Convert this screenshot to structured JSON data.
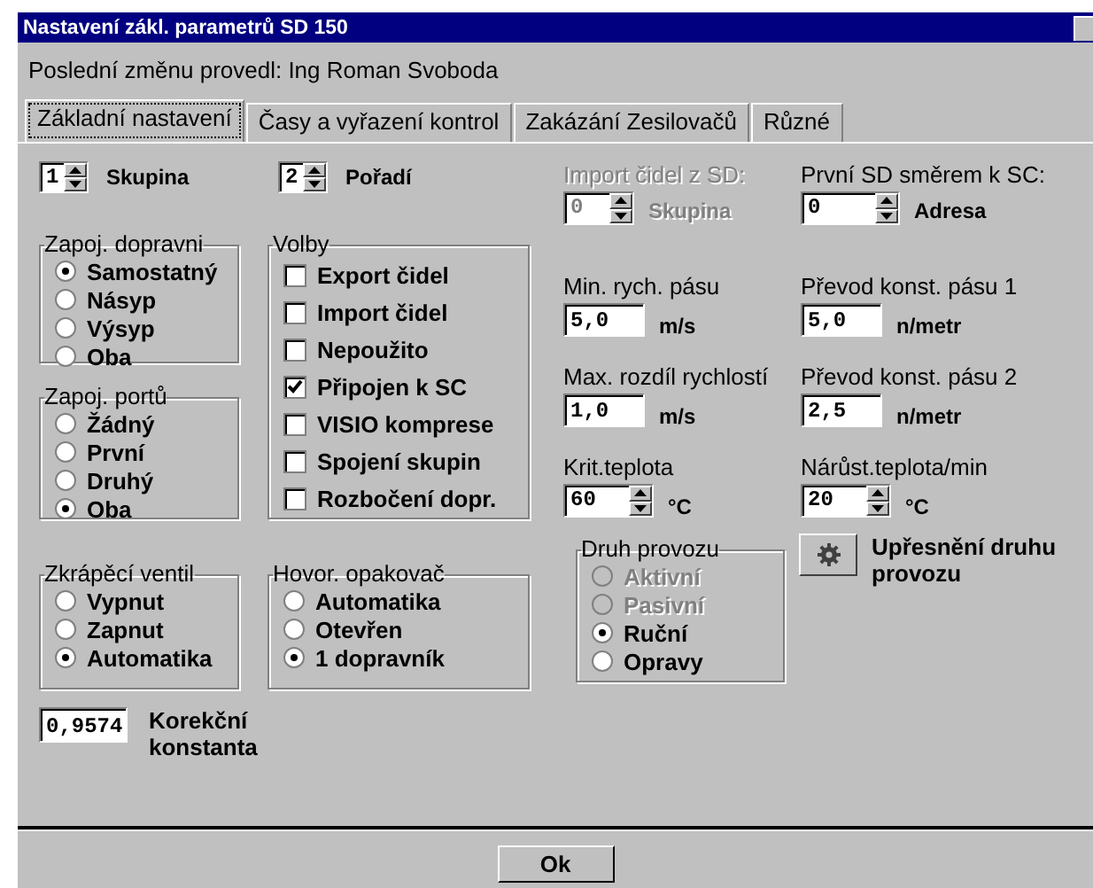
{
  "window": {
    "title": "Nastavení zákl. parametrů SD 150"
  },
  "last_change": "Poslední změnu provedl: Ing Roman Svoboda",
  "tabs": [
    {
      "label": "Základní nastavení",
      "selected": true
    },
    {
      "label": "Časy a vyřazení kontrol",
      "selected": false
    },
    {
      "label": "Zakázání Zesilovačů",
      "selected": false
    },
    {
      "label": "Různé",
      "selected": false
    }
  ],
  "top_spinners": [
    {
      "value": "1",
      "label": "Skupina"
    },
    {
      "value": "2",
      "label": "Pořadí"
    }
  ],
  "connection_groups": [
    {
      "title": "Zapoj. dopravni",
      "options": [
        {
          "label": "Samostatný",
          "selected": true
        },
        {
          "label": "Násyp",
          "selected": false
        },
        {
          "label": "Výsyp",
          "selected": false
        },
        {
          "label": "Oba",
          "selected": false
        }
      ]
    },
    {
      "title": "Zapoj. portů",
      "options": [
        {
          "label": "Žádný",
          "selected": false
        },
        {
          "label": "První",
          "selected": false
        },
        {
          "label": "Druhý",
          "selected": false
        },
        {
          "label": "Oba",
          "selected": true
        }
      ]
    }
  ],
  "options_group": {
    "title": "Volby",
    "items": [
      {
        "label": "Export čidel",
        "checked": false
      },
      {
        "label": "Import čidel",
        "checked": false
      },
      {
        "label": "Nepoužito",
        "checked": false
      },
      {
        "label": "Připojen k SC",
        "checked": true
      },
      {
        "label": "VISIO komprese",
        "checked": false
      },
      {
        "label": "Spojení skupin",
        "checked": false
      },
      {
        "label": "Rozbočení dopr.",
        "checked": false
      }
    ]
  },
  "bottom_groups": [
    {
      "title": "Zkrápěcí ventil",
      "options": [
        {
          "label": "Vypnut",
          "selected": false
        },
        {
          "label": "Zapnut",
          "selected": false
        },
        {
          "label": "Automatika",
          "selected": true
        }
      ]
    },
    {
      "title": "Hovor. opakovač",
      "options": [
        {
          "label": "Automatika",
          "selected": false
        },
        {
          "label": "Otevřen",
          "selected": false
        },
        {
          "label": "1 dopravník",
          "selected": true
        }
      ]
    }
  ],
  "correction": {
    "value": "0,9574",
    "label": "Korekční konstanta"
  },
  "sensor_import": {
    "title": "Import čidel z SD:",
    "value": "0",
    "label": "Skupina",
    "disabled": true
  },
  "first_sd": {
    "title": "První SD směrem k SC:",
    "value": "0",
    "label": "Adresa",
    "disabled": false
  },
  "fields": [
    {
      "kind": "text",
      "label": "Min. rych. pásu",
      "value": "5,0",
      "unit": "m/s"
    },
    {
      "kind": "text",
      "label": "Převod konst. pásu 1",
      "value": "5,0",
      "unit": "n/metr"
    },
    {
      "kind": "text",
      "label": "Max. rozdíl rychlostí",
      "value": "1,0",
      "unit": "m/s"
    },
    {
      "kind": "text",
      "label": "Převod konst. pásu 2",
      "value": "2,5",
      "unit": "n/metr"
    },
    {
      "kind": "spinner",
      "label": "Krit.teplota",
      "value": "60",
      "unit": "°C"
    },
    {
      "kind": "spinner",
      "label": "Nárůst.teplota/min",
      "value": "20",
      "unit": "°C"
    }
  ],
  "operation_mode": {
    "title": "Druh provozu",
    "options": [
      {
        "label": "Aktivní",
        "selected": false,
        "disabled": true
      },
      {
        "label": "Pasivní",
        "selected": false,
        "disabled": true
      },
      {
        "label": "Ruční",
        "selected": true,
        "disabled": false
      },
      {
        "label": "Opravy",
        "selected": false,
        "disabled": false
      }
    ]
  },
  "mode_detail": {
    "label": "Upřesnění druhu provozu"
  },
  "ok_button": "Ok"
}
